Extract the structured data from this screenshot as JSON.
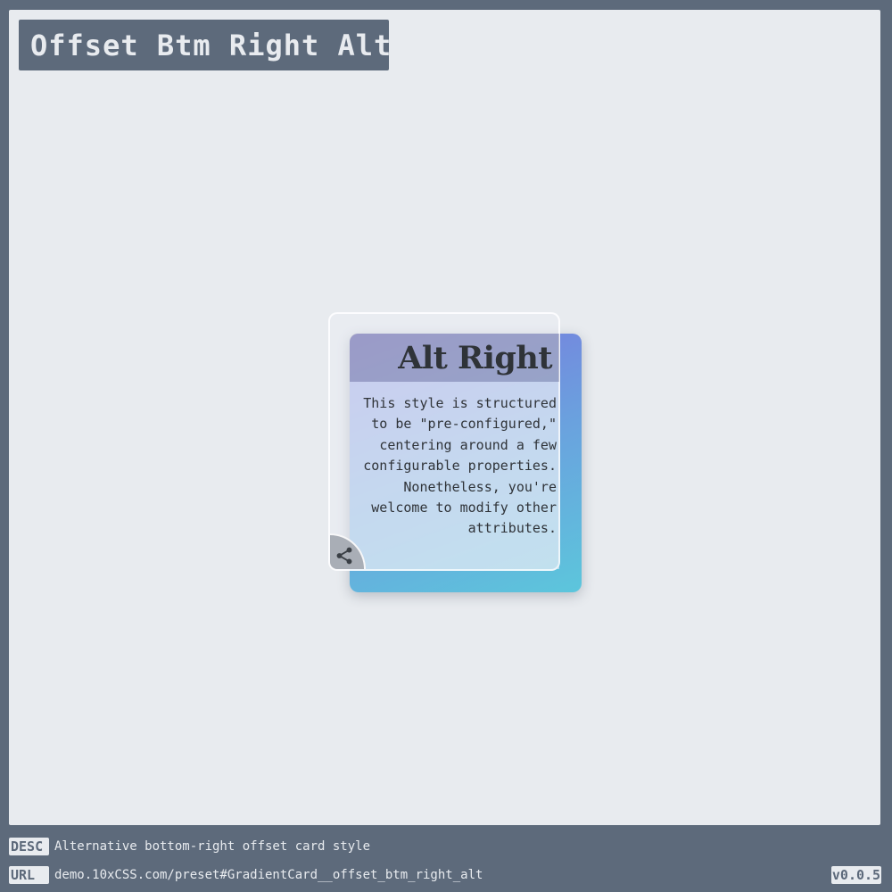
{
  "page": {
    "title": "Offset Btm Right Alt"
  },
  "card": {
    "title": "Alt Right",
    "body": "This style is structured to be \"pre-configured,\" centering around a few configurable properties. Nonetheless, you're welcome to modify other attributes.",
    "icon": "share-icon",
    "gradient_colors": [
      "#7a78dd",
      "#6aa2de",
      "#5cc6dc"
    ]
  },
  "footer": {
    "desc_tag": "DESC",
    "desc": "Alternative bottom-right offset card style",
    "url_tag": "URL",
    "url": "demo.10xCSS.com/preset#GradientCard__offset_btm_right_alt",
    "version": "v0.0.5"
  },
  "colors": {
    "background": "#5d6a7b",
    "canvas": "#e8ebef",
    "text_dark": "#2f3338"
  }
}
